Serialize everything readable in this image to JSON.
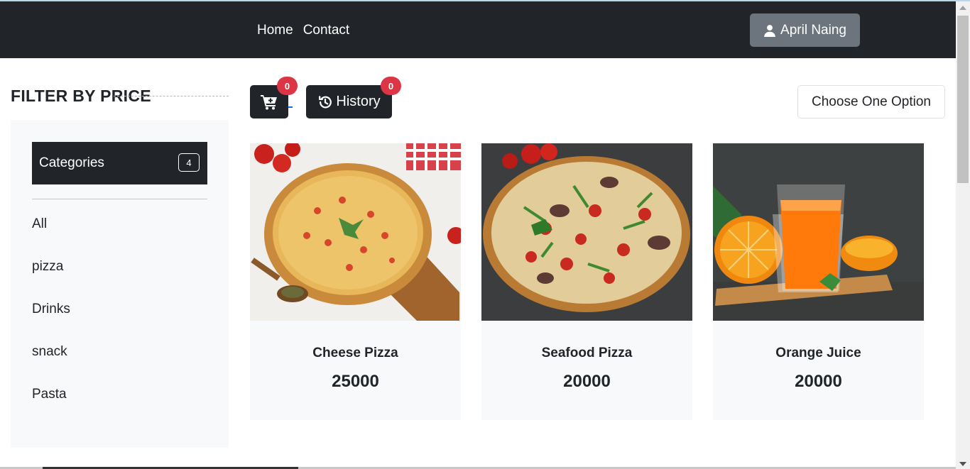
{
  "nav": {
    "links": [
      {
        "label": "Home"
      },
      {
        "label": "Contact"
      }
    ],
    "user": {
      "name": "April Naing",
      "icon": "user-icon"
    }
  },
  "sidebar": {
    "title": "FILTER BY PRICE",
    "categories_label": "Categories",
    "categories_count": "4",
    "items": [
      {
        "label": "All"
      },
      {
        "label": "pizza"
      },
      {
        "label": "Drinks"
      },
      {
        "label": "snack"
      },
      {
        "label": "Pasta"
      }
    ]
  },
  "toolbar": {
    "cart_icon": "cart-plus-icon",
    "cart_badge": "0",
    "history_label": "History",
    "history_icon": "history-icon",
    "history_badge": "0",
    "sort_select": "Choose One Option"
  },
  "products": [
    {
      "name": "Cheese Pizza",
      "price": "25000",
      "image": "cheese-pizza-image"
    },
    {
      "name": "Seafood Pizza",
      "price": "20000",
      "image": "seafood-pizza-image"
    },
    {
      "name": "Orange Juice",
      "price": "20000",
      "image": "orange-juice-image"
    }
  ],
  "colors": {
    "navbar": "#212529",
    "badge": "#dc3545",
    "user_button": "#6c757d",
    "card_bg": "#f8f9fa"
  }
}
